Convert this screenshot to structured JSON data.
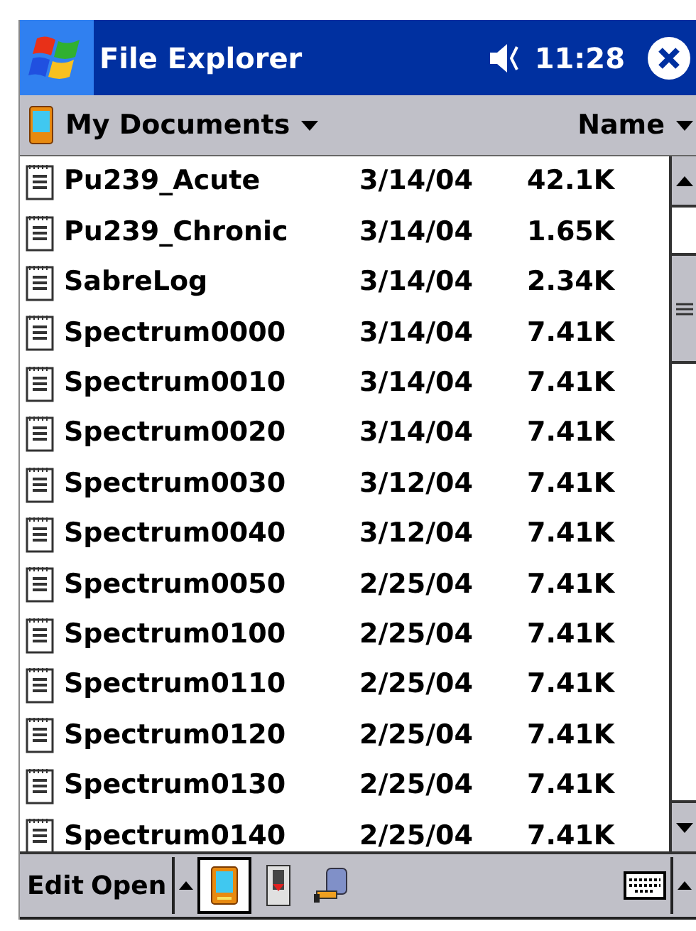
{
  "title_bar": {
    "title": "File Explorer",
    "time": "11:28"
  },
  "header": {
    "folder": "My Documents",
    "sort": "Name"
  },
  "files": [
    {
      "name": "Pu239_Acute",
      "date": "3/14/04",
      "size": "42.1K"
    },
    {
      "name": "Pu239_Chronic",
      "date": "3/14/04",
      "size": "1.65K"
    },
    {
      "name": "SabreLog",
      "date": "3/14/04",
      "size": "2.34K"
    },
    {
      "name": "Spectrum0000",
      "date": "3/14/04",
      "size": "7.41K"
    },
    {
      "name": "Spectrum0010",
      "date": "3/14/04",
      "size": "7.41K"
    },
    {
      "name": "Spectrum0020",
      "date": "3/14/04",
      "size": "7.41K"
    },
    {
      "name": "Spectrum0030",
      "date": "3/12/04",
      "size": "7.41K"
    },
    {
      "name": "Spectrum0040",
      "date": "3/12/04",
      "size": "7.41K"
    },
    {
      "name": "Spectrum0050",
      "date": "2/25/04",
      "size": "7.41K"
    },
    {
      "name": "Spectrum0100",
      "date": "2/25/04",
      "size": "7.41K"
    },
    {
      "name": "Spectrum0110",
      "date": "2/25/04",
      "size": "7.41K"
    },
    {
      "name": "Spectrum0120",
      "date": "2/25/04",
      "size": "7.41K"
    },
    {
      "name": "Spectrum0130",
      "date": "2/25/04",
      "size": "7.41K"
    },
    {
      "name": "Spectrum0140",
      "date": "2/25/04",
      "size": "7.41K"
    }
  ],
  "menu_bar": {
    "items": [
      "Edit",
      "Open"
    ],
    "tools": [
      {
        "kind": "device",
        "selected": true
      },
      {
        "kind": "card",
        "selected": false
      },
      {
        "kind": "network",
        "selected": false
      }
    ]
  }
}
